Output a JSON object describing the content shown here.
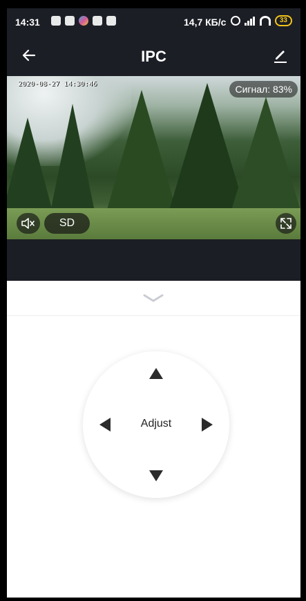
{
  "status_bar": {
    "time": "14:31",
    "network_speed": "14,7 КБ/с",
    "battery": "33",
    "notification_icons": [
      "mail-icon",
      "mail-icon",
      "app-icon",
      "mail-icon",
      "cloud-icon"
    ],
    "system_icons": [
      "alarm-icon",
      "signal-icon",
      "wifi-icon",
      "battery-icon"
    ]
  },
  "app_bar": {
    "back_icon": "arrow-left-icon",
    "title": "IPC",
    "edit_icon": "pencil-icon"
  },
  "video": {
    "timestamp": "2020-08-27 14:30:46",
    "signal_label": "Сигнал: 83%",
    "mute_icon": "speaker-muted-icon",
    "quality_label": "SD",
    "fullscreen_icon": "fullscreen-icon"
  },
  "ptz": {
    "collapse_icon": "chevron-down-icon",
    "center_label": "Adjust",
    "arrows": [
      "arrow-up-icon",
      "arrow-down-icon",
      "arrow-left-icon",
      "arrow-right-icon"
    ]
  },
  "colors": {
    "dark_bg": "#1c1e26",
    "battery": "#f5c518",
    "arrow": "#2b2b2b"
  }
}
